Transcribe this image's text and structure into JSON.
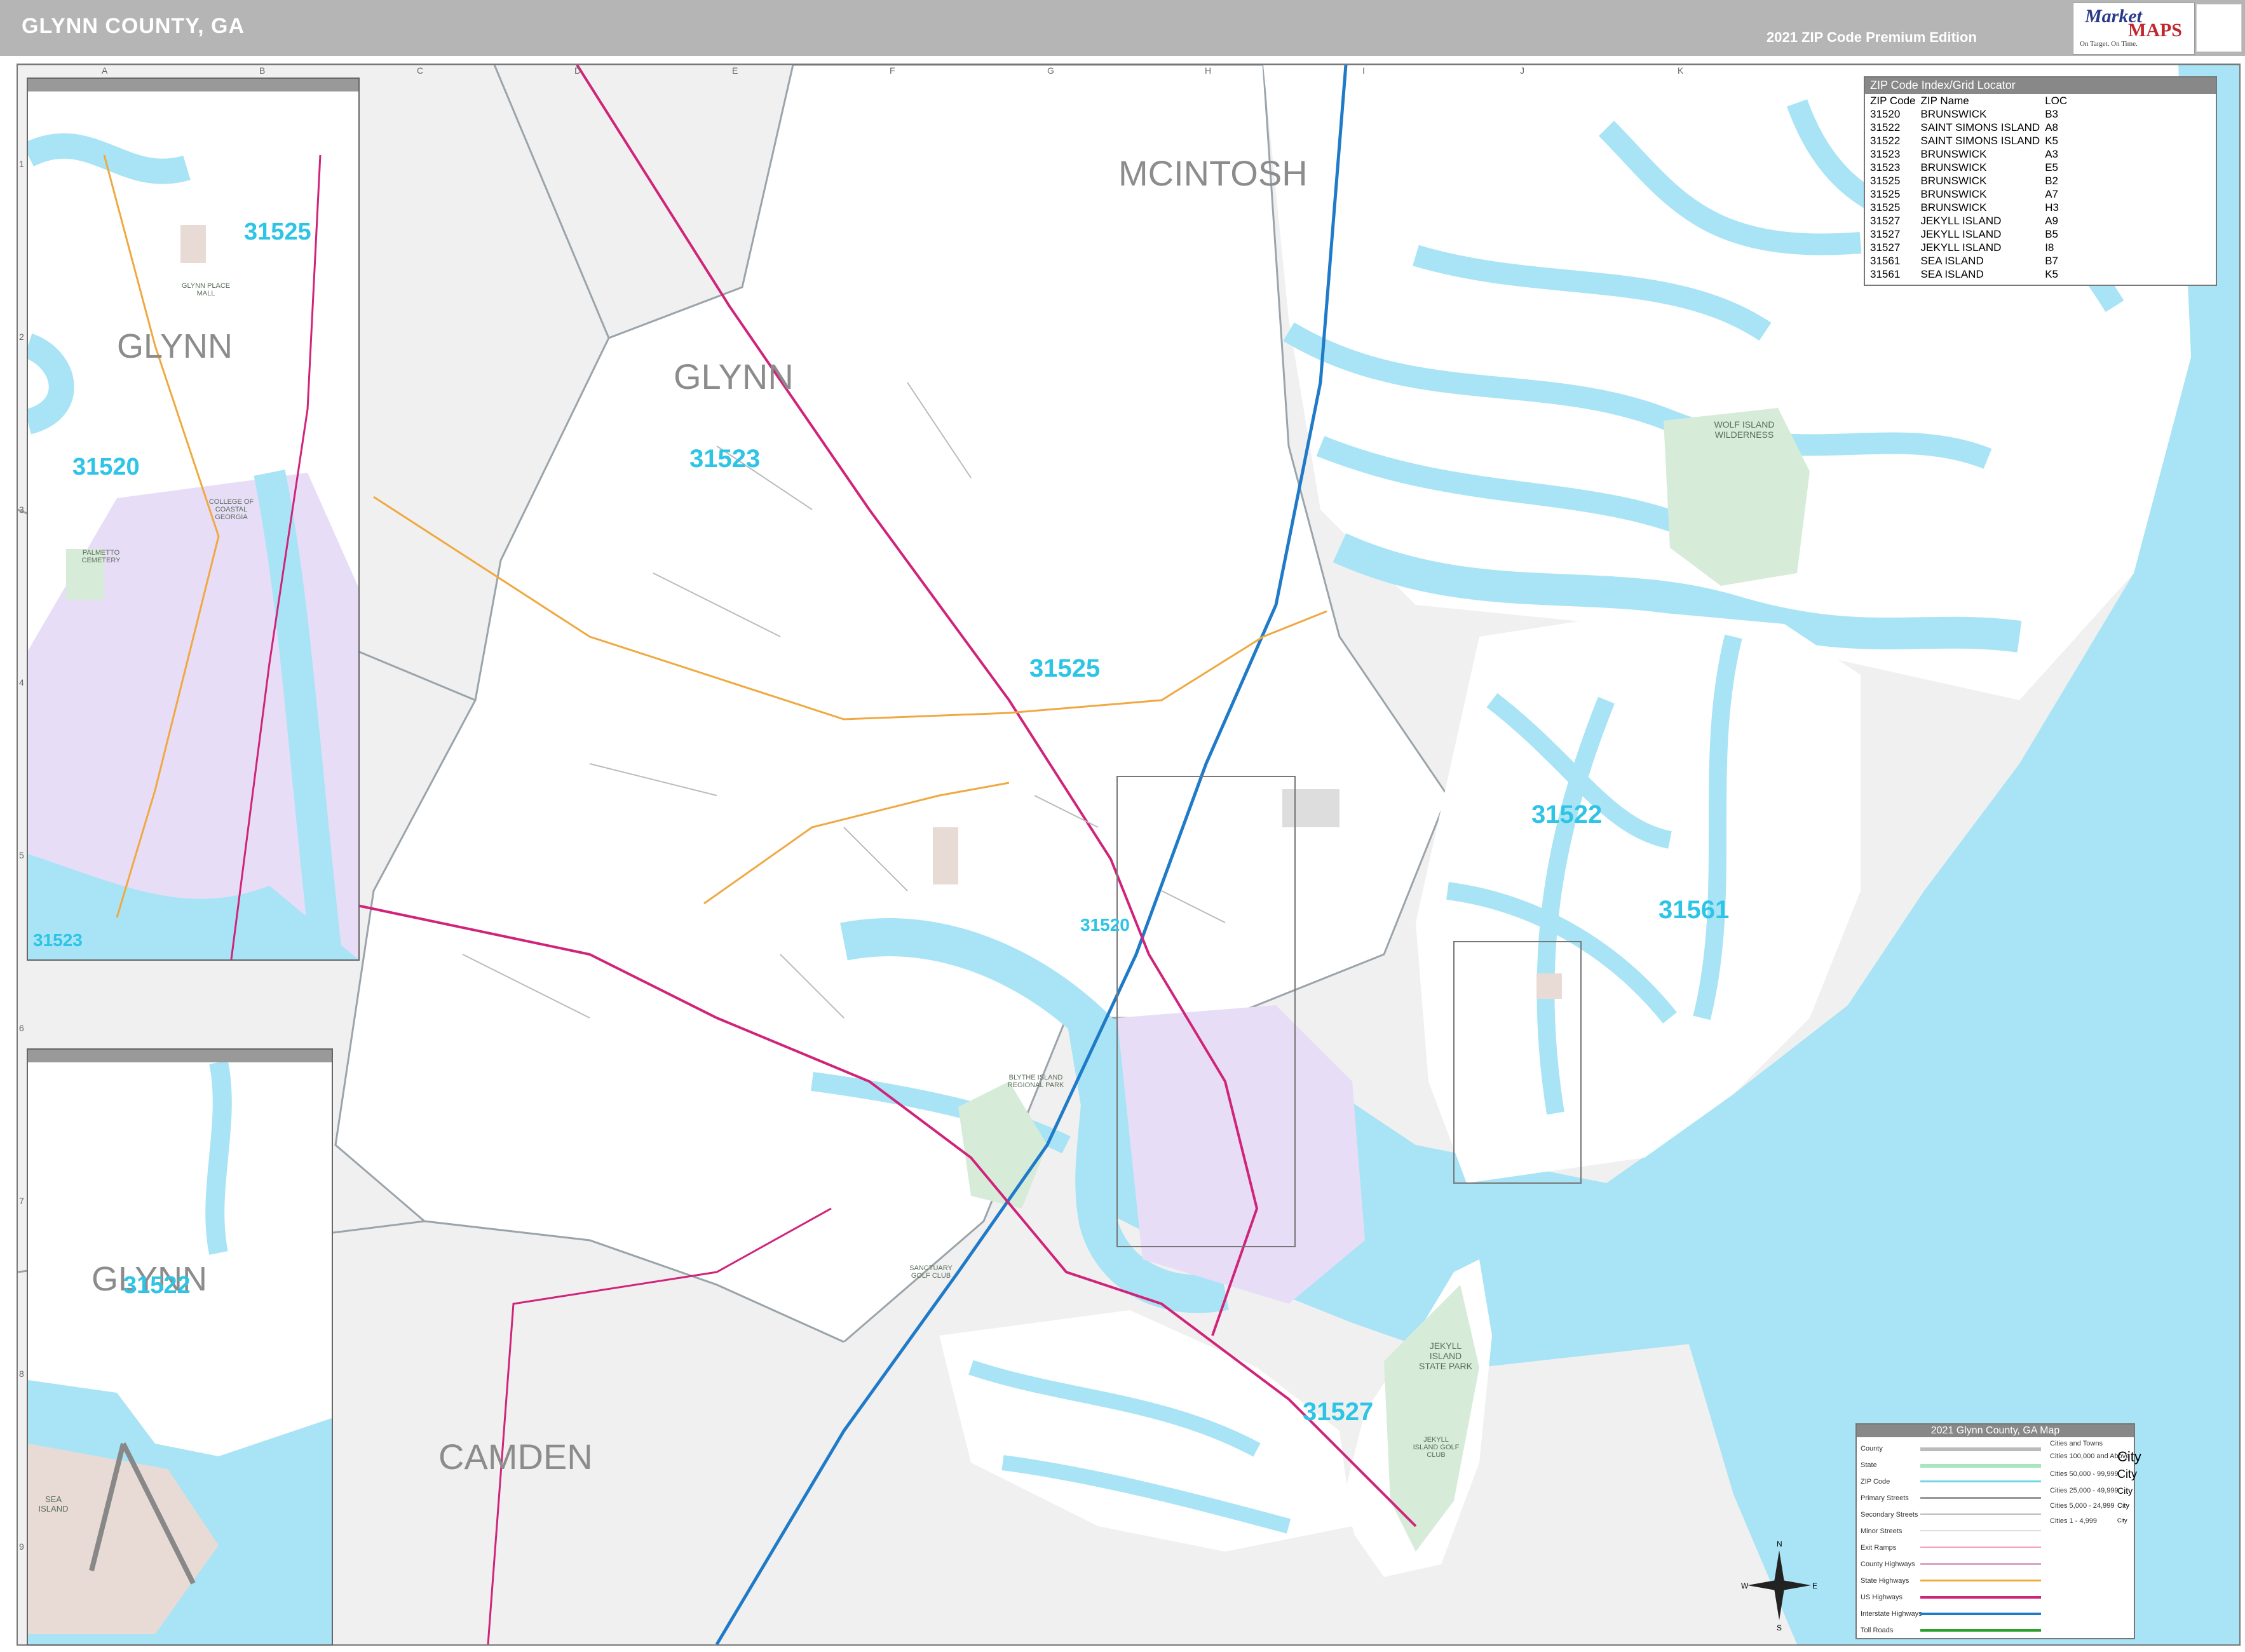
{
  "header": {
    "title": "GLYNN COUNTY, GA",
    "edition": "2021 ZIP Code Premium Edition"
  },
  "logo": {
    "word1": "Market",
    "word2": "MAPS",
    "tagline": "On Target. On Time."
  },
  "counties": {
    "mcintosh": "MCINTOSH",
    "glynn": "GLYNN",
    "camden": "CAMDEN"
  },
  "zip_labels": {
    "z31523": "31523",
    "z31525": "31525",
    "z31520": "31520",
    "z31522": "31522",
    "z31561": "31561",
    "z31527": "31527"
  },
  "parks": {
    "wolf_island": "WOLF ISLAND WILDERNESS",
    "blythe_island": "BLYTHE ISLAND REGIONAL PARK",
    "jekyll_island": "JEKYLL ISLAND STATE PARK",
    "sanctuary_golf": "SANCTUARY GOLF CLUB",
    "jekyll_golf": "JEKYLL ISLAND GOLF CLUB"
  },
  "inset_top": {
    "county": "GLYNN",
    "zip_31525": "31525",
    "zip_31520": "31520",
    "zip_31523": "31523",
    "glynn_place_mall": "GLYNN PLACE MALL",
    "college": "COLLEGE OF COASTAL GEORGIA",
    "palmetto": "PALMETTO CEMETERY"
  },
  "inset_bottom": {
    "county": "GLYNN",
    "zip_31522": "31522",
    "sea_island": "SEA ISLAND"
  },
  "index": {
    "title": "ZIP Code Index/Grid Locator",
    "headers": [
      "ZIP Code",
      "ZIP Name",
      "LOC"
    ],
    "rows": [
      [
        "31520",
        "BRUNSWICK",
        "B3"
      ],
      [
        "31522",
        "SAINT SIMONS ISLAND",
        "A8"
      ],
      [
        "31522",
        "SAINT SIMONS ISLAND",
        "K5"
      ],
      [
        "31523",
        "BRUNSWICK",
        "A3"
      ],
      [
        "31523",
        "BRUNSWICK",
        "E5"
      ],
      [
        "31525",
        "BRUNSWICK",
        "B2"
      ],
      [
        "31525",
        "BRUNSWICK",
        "A7"
      ],
      [
        "31525",
        "BRUNSWICK",
        "H3"
      ],
      [
        "31527",
        "JEKYLL ISLAND",
        "A9"
      ],
      [
        "31527",
        "JEKYLL ISLAND",
        "B5"
      ],
      [
        "31527",
        "JEKYLL ISLAND",
        "I8"
      ],
      [
        "31561",
        "SEA ISLAND",
        "B7"
      ],
      [
        "31561",
        "SEA ISLAND",
        "K5"
      ]
    ]
  },
  "legend": {
    "title": "2021 Glynn County, GA Map",
    "items": [
      "County",
      "State",
      "ZIP Code",
      "Primary Streets",
      "Secondary Streets",
      "Minor Streets",
      "Exit Ramps",
      "County Highways",
      "State Highways",
      "US Highways",
      "Interstate Highways",
      "Toll Roads"
    ],
    "cities_title": "Cities and Towns",
    "cities": [
      [
        "Cities 100,000 and Above",
        "City"
      ],
      [
        "Cities 50,000 - 99,999",
        "City"
      ],
      [
        "Cities 25,000 - 49,999",
        "City"
      ],
      [
        "Cities 5,000 - 24,999",
        "City"
      ],
      [
        "Cities 1 - 4,999",
        "City"
      ]
    ],
    "colors": {
      "county": "#bbbbbb",
      "state": "#a8e6c0",
      "zip": "#6fd6e8",
      "primary": "#999999",
      "secondary": "#bbbbbb",
      "minor": "#dddddd",
      "exit": "#f2a0c0",
      "county_hwy": "#d9a6c9",
      "state_hwy": "#f0a840",
      "us_hwy": "#d0237a",
      "interstate": "#1f7ac8",
      "toll": "#2ca02c"
    }
  },
  "compass": {
    "n": "N",
    "s": "S",
    "e": "E",
    "w": "W"
  },
  "colors": {
    "water": "#a8e4f5",
    "land": "#ffffff",
    "outside": "#f0f0f0",
    "zip_text": "#2ec4e6",
    "park": "#d7ebd9",
    "urban": "#e8dbd5",
    "zip_shade": "#e7ddf7"
  },
  "grid_letters": [
    "A",
    "B",
    "C",
    "D",
    "E",
    "F",
    "G",
    "H",
    "I",
    "J",
    "K"
  ],
  "grid_numbers": [
    "1",
    "2",
    "3",
    "4",
    "5",
    "6",
    "7",
    "8",
    "9"
  ]
}
